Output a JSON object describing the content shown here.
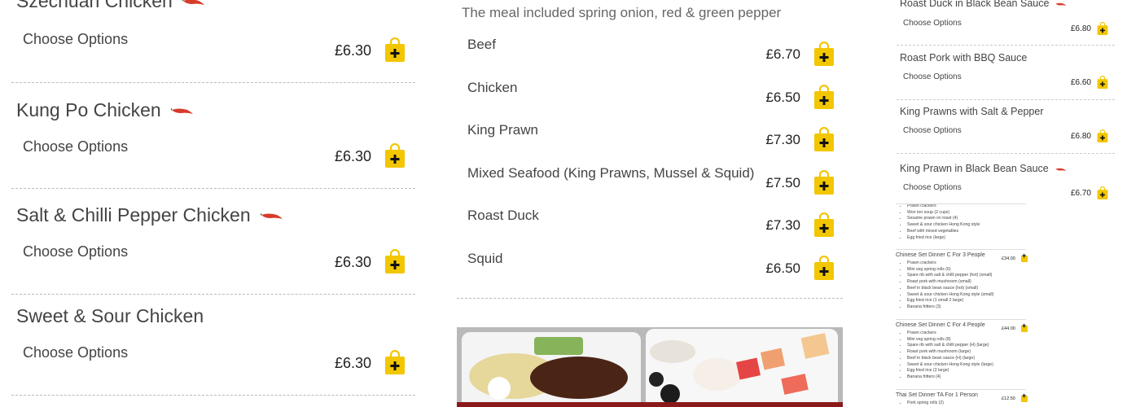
{
  "left_menu": [
    {
      "title": "Szechuan Chicken",
      "spicy": true,
      "option_label": "Choose Options",
      "price": "£6.30"
    },
    {
      "title": "Kung Po Chicken",
      "spicy": true,
      "option_label": "Choose Options",
      "price": "£6.30"
    },
    {
      "title": "Salt & Chilli Pepper Chicken",
      "spicy": true,
      "option_label": "Choose Options",
      "price": "£6.30"
    },
    {
      "title": "Sweet & Sour Chicken",
      "spicy": false,
      "option_label": "Choose Options",
      "price": "£6.30"
    }
  ],
  "middle": {
    "description": "The meal included spring onion, red & green pepper",
    "options": [
      {
        "name": "Beef",
        "price": "£6.70"
      },
      {
        "name": "Chicken",
        "price": "£6.50"
      },
      {
        "name": "King Prawn",
        "price": "£7.30"
      },
      {
        "name": "Mixed Seafood (King Prawns, Mussel & Squid)",
        "price": "£7.50"
      },
      {
        "name": "Roast Duck",
        "price": "£7.30"
      },
      {
        "name": "Squid",
        "price": "£6.50"
      }
    ]
  },
  "right_menu": [
    {
      "title": "Roast Duck in Black Bean Sauce",
      "spicy": true,
      "option_label": "Choose Options",
      "price": "£6.80"
    },
    {
      "title": "Roast Pork with BBQ Sauce",
      "spicy": false,
      "option_label": "Choose Options",
      "price": "£6.60"
    },
    {
      "title": "King Prawns with Salt & Pepper",
      "spicy": false,
      "option_label": "Choose Options",
      "price": "£6.80"
    },
    {
      "title": "King Prawn in Black Bean Sauce",
      "spicy": true,
      "option_label": "Choose Options",
      "price": "£6.70"
    }
  ],
  "set_menus": [
    {
      "title": "",
      "price": "",
      "items": [
        "Prawn crackers",
        "Won ton soup (2 cups)",
        "Sesame prawn on toast (4)",
        "Sweet & sour chicken Hong Kong style",
        "Beef with mixed vegetables",
        "Egg fried rice (large)"
      ]
    },
    {
      "title": "Chinese Set Dinner C For 3 People",
      "price": "£34.00",
      "items": [
        "Prawn crackers",
        "Mini veg spring rolls (6)",
        "Spare rib with salt & chilli pepper (hot) (small)",
        "Roast pork with mushroom (small)",
        "Beef in black bean sauce (hot) (small)",
        "Sweet & sour chicken Hong Kong style (small)",
        "Egg fried rice (1 small 2 large)",
        "Banana fritters (3)"
      ]
    },
    {
      "title": "Chinese Set Dinner C For 4 People",
      "price": "£44.00",
      "items": [
        "Prawn crackers",
        "Mini veg spring rolls (8)",
        "Spare rib with salt & chilli pepper (H) (large)",
        "Roast pork with mushroom (large)",
        "Beef in black bean sauce (H) (large)",
        "Sweet & sour chicken Hong Kong style (large)",
        "Egg fried rice (2 large)",
        "Banana fritters (4)"
      ]
    },
    {
      "title": "Thai Set Dinner TA For 1 Person",
      "price": "£12.50",
      "items": [
        "Pork spring rolls (2)"
      ]
    }
  ],
  "colors": {
    "basket": "#f2c600",
    "chili": "#d83a2a",
    "divider": "#bbbbbb"
  },
  "icons": {
    "add": "basket-add-icon",
    "spicy": "chili-icon"
  }
}
